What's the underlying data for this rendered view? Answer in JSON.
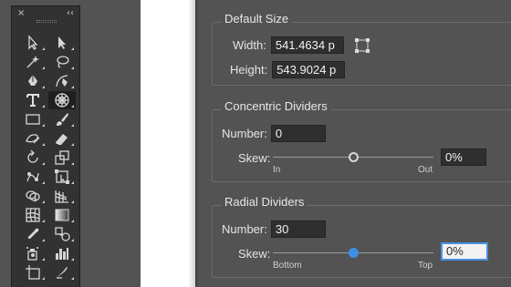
{
  "tools_panel": {
    "close_glyph": "×",
    "collapse_glyph": "‹‹",
    "tools": [
      {
        "name": "selection-tool-icon",
        "active": false
      },
      {
        "name": "direct-selection-tool-icon",
        "active": false
      },
      {
        "name": "magic-wand-tool-icon",
        "active": false
      },
      {
        "name": "lasso-tool-icon",
        "active": false
      },
      {
        "name": "pen-tool-icon",
        "active": false
      },
      {
        "name": "curvature-tool-icon",
        "active": false
      },
      {
        "name": "type-tool-icon",
        "active": false
      },
      {
        "name": "polar-grid-tool-icon",
        "active": true
      },
      {
        "name": "rectangle-tool-icon",
        "active": false
      },
      {
        "name": "paintbrush-tool-icon",
        "active": false
      },
      {
        "name": "shaper-tool-icon",
        "active": false
      },
      {
        "name": "eraser-tool-icon",
        "active": false
      },
      {
        "name": "rotate-tool-icon",
        "active": false
      },
      {
        "name": "scale-tool-icon",
        "active": false
      },
      {
        "name": "puppet-warp-tool-icon",
        "active": false
      },
      {
        "name": "free-transform-tool-icon",
        "active": false
      },
      {
        "name": "shape-builder-tool-icon",
        "active": false
      },
      {
        "name": "perspective-grid-tool-icon",
        "active": false
      },
      {
        "name": "mesh-tool-icon",
        "active": false
      },
      {
        "name": "gradient-tool-icon",
        "active": false
      },
      {
        "name": "eyedropper-tool-icon",
        "active": false
      },
      {
        "name": "blend-tool-icon",
        "active": false
      },
      {
        "name": "symbol-sprayer-tool-icon",
        "active": false
      },
      {
        "name": "column-graph-tool-icon",
        "active": false
      },
      {
        "name": "artboard-tool-icon",
        "active": false
      },
      {
        "name": "slice-tool-icon",
        "active": false
      }
    ]
  },
  "dialog": {
    "default_size": {
      "title": "Default Size",
      "width_label": "Width:",
      "width_value": "541.4634 p",
      "height_label": "Height:",
      "height_value": "543.9024 p"
    },
    "concentric": {
      "title": "Concentric Dividers",
      "number_label": "Number:",
      "number_value": "0",
      "skew_label": "Skew:",
      "skew_value": "0%",
      "skew_fraction": 0.5,
      "min_label": "In",
      "max_label": "Out"
    },
    "radial": {
      "title": "Radial Dividers",
      "number_label": "Number:",
      "number_value": "30",
      "skew_label": "Skew:",
      "skew_value": "0%",
      "skew_fraction": 0.5,
      "min_label": "Bottom",
      "max_label": "Top"
    }
  }
}
